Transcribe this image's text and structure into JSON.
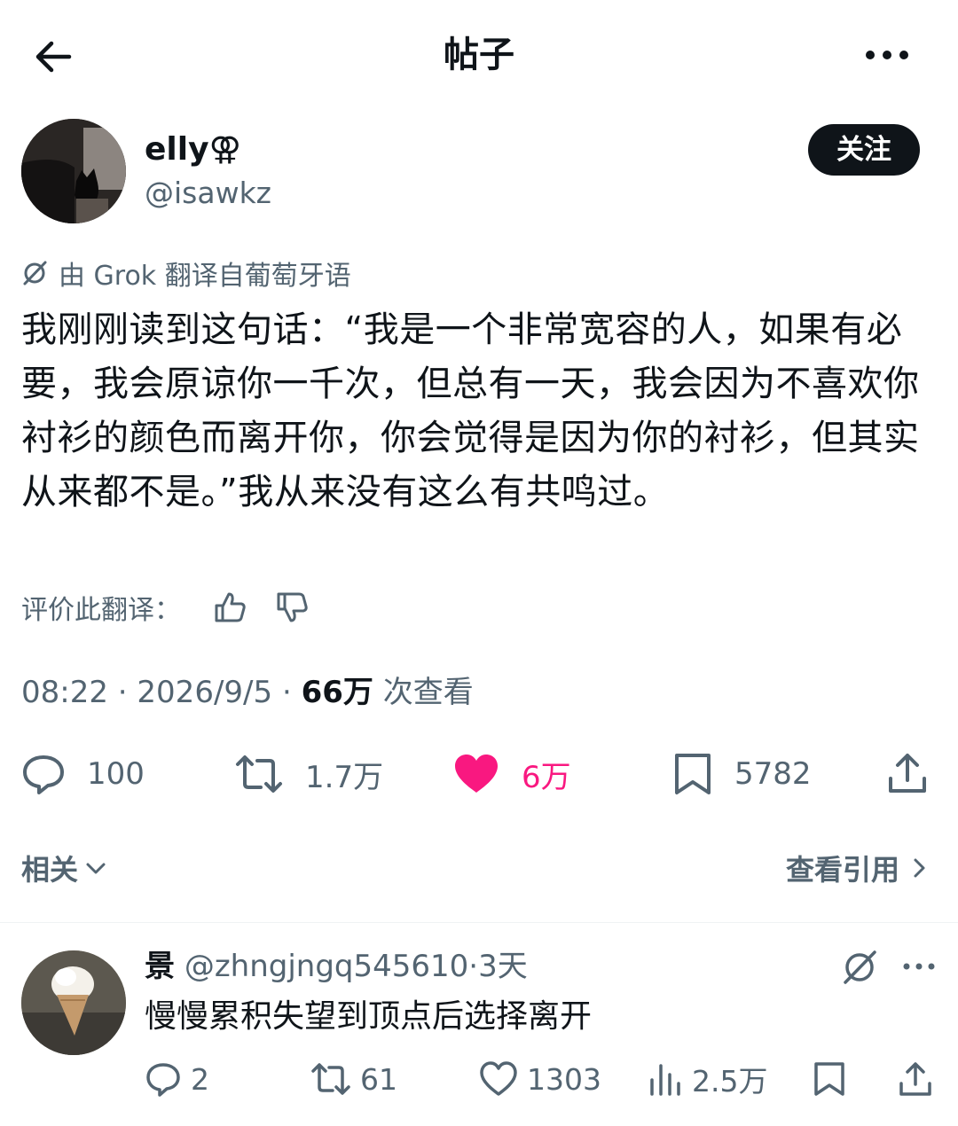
{
  "header": {
    "title": "帖子",
    "back_icon": "arrow-left-icon",
    "more_icon": "more-horizontal-icon"
  },
  "post": {
    "author_name": "elly⚢",
    "author_handle": "@isawkz",
    "follow_label": "关注",
    "translation_note": "由 Grok 翻译自葡萄牙语",
    "text": "我刚刚读到这句话：“我是一个非常宽容的人，如果有必要，我会原谅你一千次，但总有一天，我会因为不喜欢你衬衫的颜色而离开你，你会觉得是因为你的衬衫，但其实从来都不是。”我从来没有这么有共鸣过。",
    "rate_label": "评价此翻译：",
    "time": "08:22",
    "date": "2026/9/5",
    "separator": "·",
    "views_count": "66万",
    "views_label": "次查看",
    "replies": "100",
    "reposts": "1.7万",
    "likes": "6万",
    "bookmarks": "5782"
  },
  "related": {
    "label": "相关",
    "quotes_label": "查看引用"
  },
  "reply": {
    "name": "景",
    "handle": "@zhngjngq545610",
    "age": "3天",
    "text": "慢慢累积失望到顶点后选择离开",
    "replies": "2",
    "reposts": "61",
    "likes": "1303",
    "views": "2.5万"
  },
  "colors": {
    "text": "#0f1419",
    "secondary": "#536471",
    "like": "#f91880",
    "divider": "#eff3f4"
  }
}
